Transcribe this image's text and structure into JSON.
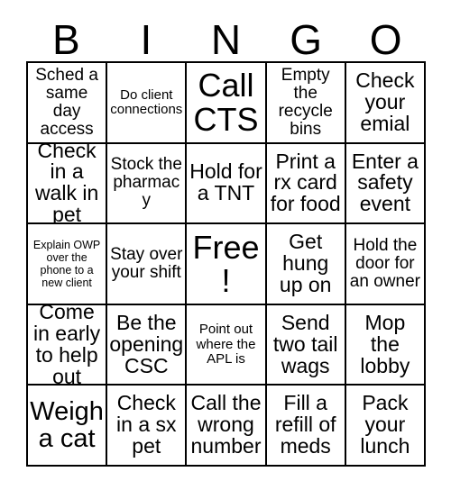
{
  "card": {
    "title": "BINGO",
    "header_letters": [
      "B",
      "I",
      "N",
      "G",
      "O"
    ],
    "free_space_label": "Free!",
    "columns": 5,
    "rows": 5,
    "grid_line_color": "#000000",
    "background_color": "#ffffff",
    "text_color": "#000000",
    "cells": [
      {
        "text": "Sched a same day access",
        "size": "md"
      },
      {
        "text": "Do client connections",
        "size": "sm"
      },
      {
        "text": "Call CTS",
        "size": "xxl"
      },
      {
        "text": "Empty the recycle bins",
        "size": "md"
      },
      {
        "text": "Check your emial",
        "size": "lg"
      },
      {
        "text": "Check in a walk in pet",
        "size": "lg"
      },
      {
        "text": "Stock the pharmacy",
        "size": "md"
      },
      {
        "text": "Hold for a TNT",
        "size": "lg"
      },
      {
        "text": "Print a rx card for food",
        "size": "lg"
      },
      {
        "text": "Enter a safety event",
        "size": "lg"
      },
      {
        "text": "Explain OWP over the phone to a new client",
        "size": "xs"
      },
      {
        "text": "Stay over your shift",
        "size": "md"
      },
      {
        "text": "Free!",
        "size": "xxl"
      },
      {
        "text": "Get hung up on",
        "size": "lg"
      },
      {
        "text": "Hold the door for an owner",
        "size": "md"
      },
      {
        "text": "Come in early to help out",
        "size": "lg"
      },
      {
        "text": "Be the opening CSC",
        "size": "lg"
      },
      {
        "text": "Point out where the APL is",
        "size": "sm"
      },
      {
        "text": "Send two tail wags",
        "size": "lg"
      },
      {
        "text": "Mop the lobby",
        "size": "lg"
      },
      {
        "text": "Weigh a cat",
        "size": "xl"
      },
      {
        "text": "Check in a sx pet",
        "size": "lg"
      },
      {
        "text": "Call the wrong number",
        "size": "lg"
      },
      {
        "text": "Fill a refill of meds",
        "size": "lg"
      },
      {
        "text": "Pack your lunch",
        "size": "lg"
      }
    ]
  }
}
